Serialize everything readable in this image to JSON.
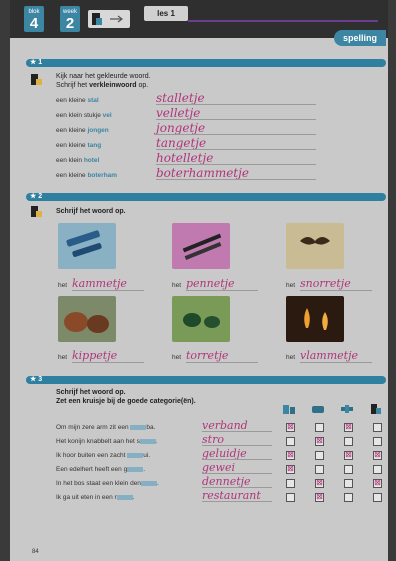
{
  "header": {
    "blok_label": "blok",
    "blok_num": "4",
    "week_label": "week",
    "week_num": "2",
    "les": "les 1",
    "tab": "spelling"
  },
  "sec1": {
    "num": "1",
    "line1": "Kijk naar het gekleurde woord.",
    "line2a": "Schrijf het ",
    "line2b": "verkleinwoord",
    "line2c": " op.",
    "rows": [
      {
        "pre": "een kleine ",
        "word": "stal",
        "ans": "stalletje"
      },
      {
        "pre": "een klein stukje ",
        "word": "vel",
        "ans": "velletje"
      },
      {
        "pre": "een kleine ",
        "word": "jongen",
        "ans": "jongetje"
      },
      {
        "pre": "een kleine ",
        "word": "tang",
        "ans": "tangetje"
      },
      {
        "pre": "een klein ",
        "word": "hotel",
        "ans": "hotelletje"
      },
      {
        "pre": "een kleine ",
        "word": "boterham",
        "ans": "boterhammetje"
      }
    ]
  },
  "sec2": {
    "num": "2",
    "instr": "Schrijf het woord op.",
    "het": "het",
    "items": [
      {
        "ans": "kammetje",
        "pic": "comb-image"
      },
      {
        "ans": "pennetje",
        "pic": "pen-image"
      },
      {
        "ans": "snorretje",
        "pic": "moustache-image"
      },
      {
        "ans": "kippetje",
        "pic": "chickens-image"
      },
      {
        "ans": "torretje",
        "pic": "beetle-image"
      },
      {
        "ans": "vlammetje",
        "pic": "flame-image"
      }
    ]
  },
  "sec3": {
    "num": "3",
    "line1": "Schrijf het woord op.",
    "line2": "Zet een kruisje bij de goede categorie(ën).",
    "rows": [
      {
        "a": "Om mijn zere arm zit een ",
        "b": "ba",
        "c": ".",
        "ans": "verband",
        "checks": [
          true,
          false,
          true,
          false
        ]
      },
      {
        "a": "Het konijn knabbelt aan het s",
        "b": "",
        "c": ".",
        "ans": "stro",
        "checks": [
          false,
          true,
          false,
          false
        ]
      },
      {
        "a": "Ik hoor buiten een zacht ",
        "b": "ui",
        "c": ".",
        "ans": "geluidje",
        "checks": [
          true,
          false,
          true,
          true
        ]
      },
      {
        "a": "Een edelhert heeft een g",
        "b": "",
        "c": ".",
        "ans": "gewei",
        "checks": [
          true,
          false,
          false,
          false
        ]
      },
      {
        "a": "In het bos staat een klein den",
        "b": "",
        "c": ".",
        "ans": "dennetje",
        "checks": [
          false,
          true,
          false,
          true
        ]
      },
      {
        "a": "Ik ga uit eten in een r",
        "b": "",
        "c": ".",
        "ans": "restaurant",
        "checks": [
          false,
          true,
          false,
          false
        ]
      }
    ],
    "check_mark": "☒"
  },
  "footer": {
    "page": "84"
  },
  "colors": {
    "accent": "#3c86a3",
    "answer": "#b0357a",
    "purple": "#6c3d8f"
  }
}
